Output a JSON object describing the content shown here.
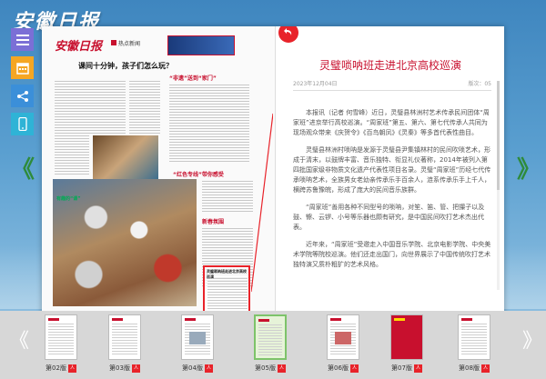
{
  "app": {
    "masthead": "安徽日报"
  },
  "toolbar": {
    "items": [
      {
        "icon": "menu-icon"
      },
      {
        "icon": "calendar-icon"
      },
      {
        "icon": "share-icon"
      },
      {
        "icon": "phone-icon"
      }
    ]
  },
  "navigation": {
    "prev": "《",
    "next": "》"
  },
  "newspaper_page": {
    "logo": "安徽日报",
    "section_tag": "热点新闻",
    "headline": "课间十分钟，孩子们怎么玩？",
    "section_title_1": "“非遗”送到“家门”",
    "section_title_2": "“红色专线”带你感受",
    "section_title_3": "新春氛围",
    "photo_label": "有趣的“课”",
    "highlight_title": "灵璧唢呐班走进北京高校巡演"
  },
  "article": {
    "title": "灵璧唢呐班走进北京高校巡演",
    "date": "2023年12月04日",
    "page": "版次：05",
    "paragraphs": [
      "本报讯（记者 何雪峰）近日，灵璧县林洲村艺术传承民间团体“周家班”进京举行高校巡演。“周家班”第五、第六、第七代传承人共同为现场观众带来《庆贺令》《百鸟朝凤》《灵秦》等多首代表性曲目。",
      "灵璧县林洲村唢呐是发源于灵璧县尹集镇林村的民间吹唢艺术，形成于清末，以鼓牌丰富、音乐独特、衔显礼仪著称，2014年被列入第四批国家级非物质文化遗产代表性项目名录。灵璧“周家班”历经七代传承唢呐艺术，全族男女老幼亲传承乐手百余人，涟系传承乐手上千人，横跨苏鲁豫皖，形成了庞大的民间音乐族群。",
      "“周家班”善用各种不同型号的唢呐，对笙、笛、管、把攥子以及鼓、镲、云锣、小号等乐器也颇有研究，是中国民间吹打艺术杰出代表。",
      "近年来，“周家班”受邀走入中国音乐学院、北京电影学院、中央美术学院等院校巡演。他们还走出国门，向世界展示了中国传统吹打艺术独特演又质朴粗犷的艺术风格。"
    ]
  },
  "thumbnails": [
    {
      "label": "第02版",
      "pdf": "人"
    },
    {
      "label": "第03版",
      "pdf": "人"
    },
    {
      "label": "第04版",
      "pdf": "人"
    },
    {
      "label": "第05版",
      "pdf": "人"
    },
    {
      "label": "第06版",
      "pdf": "人"
    },
    {
      "label": "第07版",
      "pdf": "人"
    },
    {
      "label": "第08版",
      "pdf": "人"
    }
  ],
  "colors": {
    "accent": "#c8102e",
    "active_thumb": "#7dc36a",
    "nav_arrow": "#2e8b3a"
  }
}
